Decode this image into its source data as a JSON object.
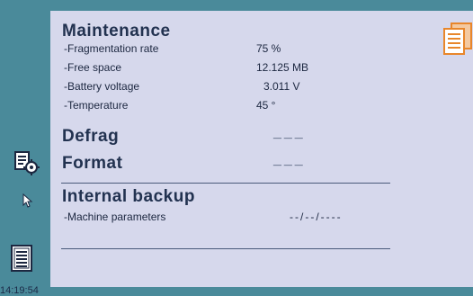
{
  "maintenance": {
    "title": "Maintenance",
    "rows": [
      {
        "label": "-Fragmentation rate",
        "value": "75 %"
      },
      {
        "label": "-Free space",
        "value": "12.125 MB"
      },
      {
        "label": "-Battery voltage",
        "value": "3.011 V"
      },
      {
        "label": "-Temperature",
        "value": "45 °"
      }
    ]
  },
  "defrag": {
    "label": "Defrag",
    "value": "___"
  },
  "format": {
    "label": "Format",
    "value": "___"
  },
  "backup": {
    "title": "Internal backup",
    "rows": [
      {
        "label": "-Machine parameters",
        "value": "--/--/----"
      }
    ]
  },
  "status": {
    "clock": "14:19:54"
  },
  "colors": {
    "sidebar": "#4a8a9a",
    "panel": "#d6d8ec",
    "accent_orange": "#e8862a"
  },
  "icons": {
    "settings_doc": "document-gear-icon",
    "cursor": "pointer-cursor-icon",
    "doc_list": "document-list-icon",
    "copy_docs": "copy-documents-icon"
  }
}
